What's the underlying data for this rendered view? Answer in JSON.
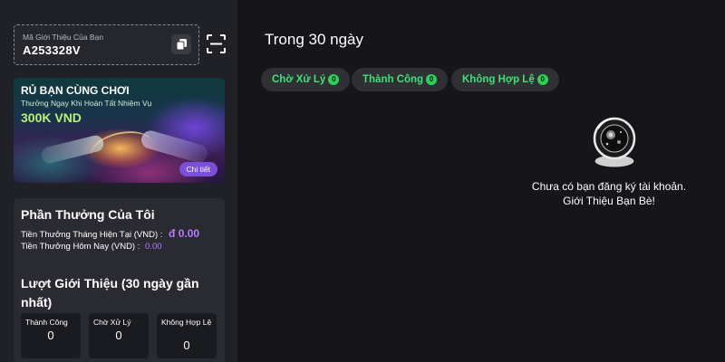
{
  "referral": {
    "label": "Mã Giới Thiệu Của Bạn",
    "code": "A253328V"
  },
  "banner": {
    "title": "RỦ BẠN CÙNG CHƠI",
    "subtitle": "Thưởng Ngay Khi Hoàn Tất Nhiệm Vụ",
    "amount": "300K VND",
    "detail_label": "Chi tiết"
  },
  "rewards": {
    "title": "Phần Thưởng Của Tôi",
    "month_label": "Tiền Thưởng Tháng Hiện Tại (VND) :",
    "month_value": "đ 0.00",
    "today_label": "Tiền Thưởng Hôm Nay (VND) :",
    "today_value": "0.00"
  },
  "referrals": {
    "title": "Lượt Giới Thiệu (30 ngày gần nhất)",
    "stats": [
      {
        "label": "Thành Công",
        "value": "0"
      },
      {
        "label": "Chờ Xử Lý",
        "value": "0"
      },
      {
        "label": "Không Hợp Lệ",
        "value": "0"
      }
    ]
  },
  "main": {
    "period": "Trong 30 ngày",
    "tabs": [
      {
        "label": "Chờ Xử Lý",
        "count": "0"
      },
      {
        "label": "Thành Công",
        "count": "0"
      },
      {
        "label": "Không Hợp Lệ",
        "count": "0"
      }
    ],
    "empty_line1": "Chưa có bạn đăng ký tài khoản.",
    "empty_line2": "Giới Thiệu Bạn Bè!"
  },
  "colors": {
    "accent_green": "#3ee077",
    "accent_purple": "#b57cff",
    "banner_amount": "#b9f07a"
  },
  "icons": {
    "copy": "copy-icon",
    "scan": "scan-icon",
    "empty_state": "astronaut-icon"
  }
}
